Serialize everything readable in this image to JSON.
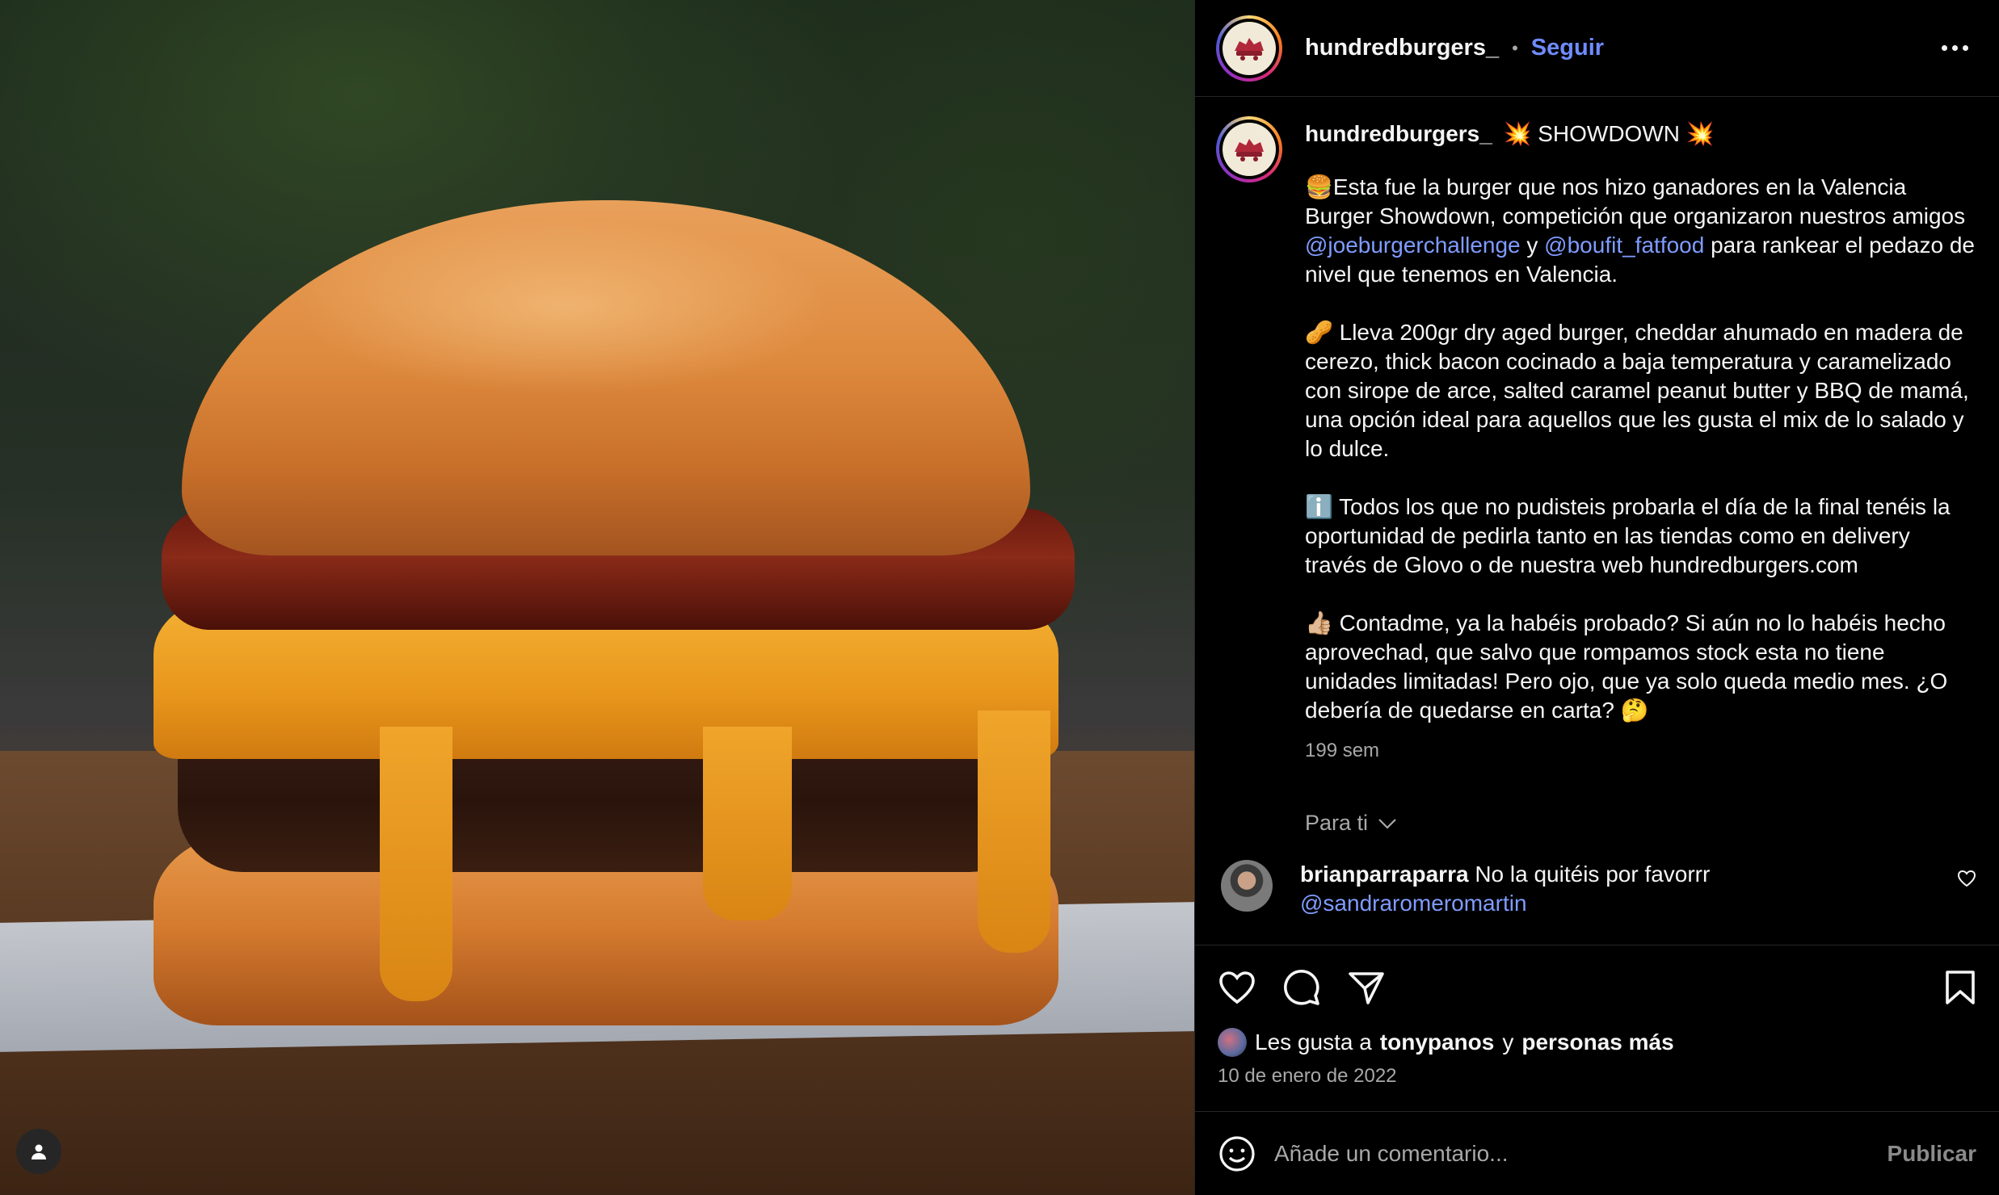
{
  "post": {
    "username": "hundredburgers_",
    "follow_label": "Seguir",
    "separator": "•"
  },
  "caption": {
    "username": "hundredburgers_",
    "headline": "💥 SHOWDOWN 💥",
    "p1_a": "🍔Esta fue la burger que nos hizo ganadores en la Valencia Burger Showdown, competición que organizaron nuestros amigos ",
    "mention1": "@joeburgerchallenge",
    "p1_b": " y ",
    "mention2": "@boufit_fatfood",
    "p1_c": " para rankear el pedazo de nivel que tenemos en Valencia.",
    "p2": "🥜 Lleva 200gr dry aged burger, cheddar ahumado en madera de cerezo, thick bacon cocinado a baja temperatura y caramelizado con sirope de arce, salted caramel peanut butter y BBQ de mamá, una opción ideal para aquellos que les gusta el mix de lo salado y lo dulce.",
    "p3": "ℹ️ Todos los que no pudisteis probarla el día de la final tenéis la oportunidad de pedirla tanto en las tiendas como en delivery través de Glovo o de nuestra web hundredburgers.com",
    "p4": "👍🏼 Contadme, ya la habéis probado? Si aún no lo habéis hecho aprovechad, que salvo que rompamos stock esta no tiene unidades limitadas! Pero ojo, que ya solo queda medio mes. ¿O debería de quedarse en carta? 🤔",
    "time_ago": "199 sem"
  },
  "filter": {
    "label": "Para ti"
  },
  "comments": [
    {
      "username": "brianparraparra",
      "text": "No la quitéis por favorrr",
      "mention": "@sandraromeromartin"
    }
  ],
  "likes": {
    "prefix": "Les gusta a",
    "user": "tonypanos",
    "conj": "y",
    "others": "personas más"
  },
  "date": "10 de enero de 2022",
  "comment_box": {
    "placeholder": "Añade un comentario...",
    "publish_label": "Publicar"
  },
  "colors": {
    "accent": "#6f8cff",
    "mention": "#7f9cff",
    "background": "#000000",
    "muted": "#a8a8a8"
  },
  "icons": [
    "user-icon",
    "more-icon",
    "chevron-down-icon",
    "heart-icon",
    "comment-icon",
    "share-icon",
    "bookmark-icon",
    "emoji-icon"
  ]
}
